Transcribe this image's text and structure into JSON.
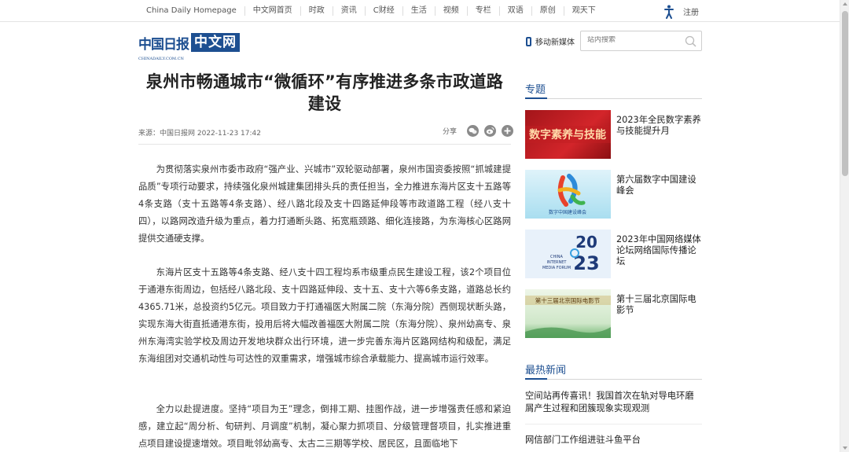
{
  "topnav": {
    "links": [
      "China Daily Homepage",
      "中文网首页",
      "时政",
      "资讯",
      "C财经",
      "生活",
      "视频",
      "专栏",
      "双语",
      "原创",
      "观天下"
    ],
    "register": "注册"
  },
  "header": {
    "logo_cn_daily": "中国日报",
    "logo_domain": "CHINADAILY.COM.CN",
    "logo_cn_web": "中文网",
    "mobile_label": "移动新媒体",
    "search_placeholder": "站内搜索"
  },
  "article": {
    "title": "泉州市畅通城市“微循环”有序推进多条市政道路建设",
    "meta": "来源：中国日报网  2022-11-23 17:42",
    "share_label": "分享",
    "paragraphs": [
      "为贯彻落实泉州市委市政府“强产业、兴城市”双轮驱动部署，泉州市国资委按照“抓城建提品质”专项行动要求，持续强化泉州城建集团排头兵的责任担当，全力推进东海片区支十五路等4条支路（支十五路等4条支路）、经八路北段及支十四路延伸段等市政道路工程（经八支十四），以路网改造升级为重点，着力打通断头路、拓宽瓶颈路、细化连接路，为东海核心区路网提供交通硬支撑。",
      "东海片区支十五路等4条支路、经八支十四工程均系市级重点民生建设工程，该2个项目位于通港东街周边，包括经八路北段、支十四路延伸段、支十五、支十六等6条支路，道路总长约4365.71米，总投资约5亿元。项目致力于打通福医大附属二院（东海分院）西侧现状断头路，实现东海大街直抵通港东街，投用后将大幅改善福医大附属二院（东海分院）、泉州幼高专、泉州东海湾实验学校及周边开发地块群众出行环境，进一步完善东海片区路网结构和级配，满足东海组团对交通机动性与可达性的双重需求，增强城市综合承载能力、提高城市运行效率。",
      "全力以赴提进度。坚持“项目为王”理念，倒排工期、挂图作战，进一步增强责任感和紧迫感，建立起“周分析、旬研判、月调度”机制，凝心聚力抓项目、分级管理督项目，扎实推进重点项目建设提速增效。项目毗邻幼高专、太古二三期等学校、居民区，且面临地下"
    ]
  },
  "sidebar": {
    "topics_title": "专题",
    "topics": [
      {
        "caption": "2023年全民数字素养与技能提升月",
        "thumb_text": "数字素养与技能"
      },
      {
        "caption": "第六届数字中国建设峰会",
        "thumb_text": "数字中国建设峰会"
      },
      {
        "caption": "2023年中国网络媒体论坛网络国际传播论坛",
        "thumb_text_1": "CHINA",
        "thumb_text_2": "INTERNET",
        "thumb_text_3": "MEDIA FORUM",
        "thumb_year_top": "20",
        "thumb_year_bottom": "23"
      },
      {
        "caption": "第十三届北京国际电影节",
        "thumb_text": "第十三届北京国际电影节"
      }
    ],
    "news_title": "最热新闻",
    "news": [
      "空间站再传喜讯！我国首次在轨对导电环磨屑产生过程和团簇现象实现观测",
      "网信部门工作组进驻斗鱼平台"
    ]
  },
  "colors": {
    "brand": "#1d4f91",
    "text": "#333333"
  }
}
